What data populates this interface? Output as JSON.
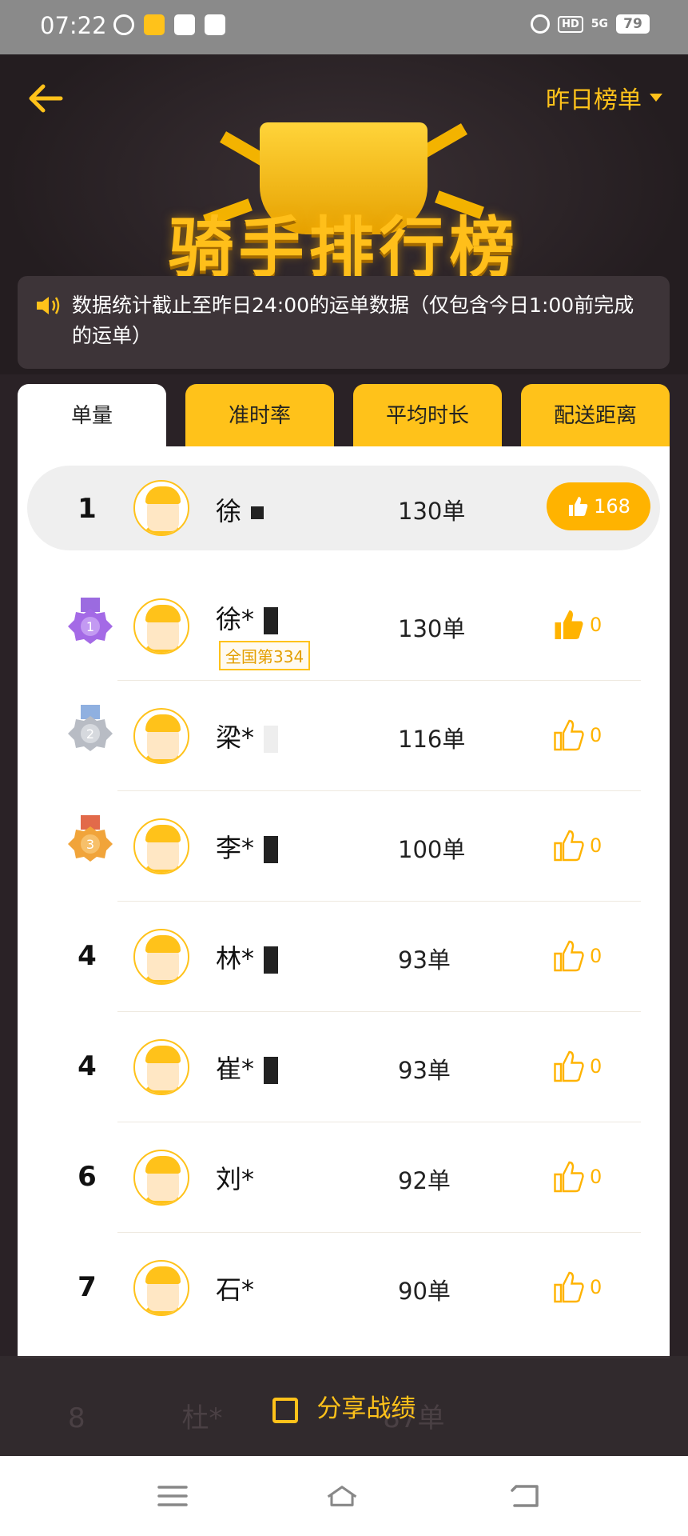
{
  "status_bar": {
    "time": "07:22",
    "hd": "HD",
    "signal": "5G",
    "battery": "79"
  },
  "header": {
    "range_label": "昨日榜单",
    "title": "骑手排行榜",
    "notice": "数据统计截止至昨日24:00的运单数据（仅包含今日1:00前完成的运单）"
  },
  "tabs": [
    {
      "label": "单量",
      "active": true
    },
    {
      "label": "准时率",
      "active": false
    },
    {
      "label": "平均时长",
      "active": false
    },
    {
      "label": "配送距离",
      "active": false
    }
  ],
  "my_row": {
    "rank": "1",
    "name": "徐",
    "orders": "130单",
    "likes": "168"
  },
  "rows": [
    {
      "rank": "1",
      "medal": "gold-purple",
      "name": "徐*",
      "badge": "全国第334",
      "orders": "130单",
      "likes": "0",
      "liked": true
    },
    {
      "rank": "2",
      "medal": "silver",
      "name": "梁*",
      "orders": "116单",
      "likes": "0",
      "liked": false
    },
    {
      "rank": "3",
      "medal": "bronze",
      "name": "李*",
      "orders": "100单",
      "likes": "0",
      "liked": false
    },
    {
      "rank": "4",
      "name": "林*",
      "orders": "93单",
      "likes": "0",
      "liked": false
    },
    {
      "rank": "4",
      "name": "崔*",
      "orders": "93单",
      "likes": "0",
      "liked": false
    },
    {
      "rank": "6",
      "name": "刘*",
      "orders": "92单",
      "likes": "0",
      "liked": false
    },
    {
      "rank": "7",
      "name": "石*",
      "orders": "90单",
      "likes": "0",
      "liked": false
    }
  ],
  "peek_row": {
    "rank": "8",
    "name": "杜*",
    "orders": "87单"
  },
  "share": {
    "label": "分享战绩"
  },
  "colors": {
    "accent": "#ffc21a",
    "dark_bg": "#2a2226"
  }
}
